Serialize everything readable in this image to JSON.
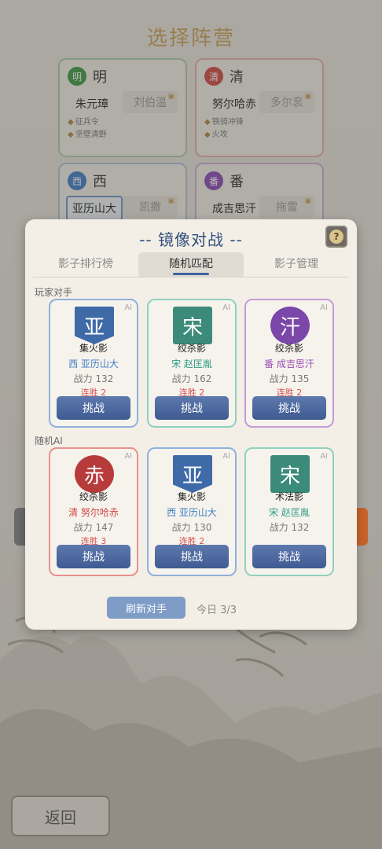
{
  "background": {
    "title": "选择阵营",
    "factions": [
      {
        "badge": "明",
        "name": "明",
        "leader": "朱元璋",
        "alt": "刘伯温",
        "skills": [
          "征兵令",
          "坚壁清野"
        ],
        "color": "#3a9a45"
      },
      {
        "badge": "清",
        "name": "清",
        "leader": "努尔哈赤",
        "alt": "多尔衮",
        "skills": [
          "铁骑冲锋",
          "火攻"
        ],
        "color": "#d24a45"
      },
      {
        "badge": "西",
        "name": "西",
        "leader": "亚历山大",
        "alt": "凯撒",
        "skills": [],
        "color": "#3e7fc8"
      },
      {
        "badge": "番",
        "name": "番",
        "leader": "成吉思汗",
        "alt": "拖雷",
        "skills": [],
        "color": "#8a4ab8"
      }
    ],
    "back_label": "返回"
  },
  "modal": {
    "title": "-- 镜像对战 --",
    "help": "?",
    "tabs": [
      "影子排行榜",
      "随机匹配",
      "影子管理"
    ],
    "active_tab": 1,
    "sections": [
      {
        "label": "玩家对手",
        "cards": [
          {
            "ai": "AI",
            "emblem": "亚",
            "shape": "banner",
            "emblem_color": "#3f6aa8",
            "border": "#8fb1dc",
            "name": "集火影",
            "faction": "西  亚历山大",
            "faction_color": "#3f7fc6",
            "power": "战力 132",
            "streak": "连胜 2",
            "button": "挑战"
          },
          {
            "ai": "AI",
            "emblem": "宋",
            "shape": "square",
            "emblem_color": "#3c8b7a",
            "border": "#8fd1c0",
            "name": "绞杀影",
            "faction": "宋  赵匡胤",
            "faction_color": "#2e9c86",
            "power": "战力 162",
            "streak": "连胜 2",
            "button": "挑战"
          },
          {
            "ai": "AI",
            "emblem": "汗",
            "shape": "round",
            "emblem_color": "#7b47a8",
            "border": "#c79ad8",
            "name": "绞杀影",
            "faction": "番  成吉思汗",
            "faction_color": "#9b4db8",
            "power": "战力 135",
            "streak": "连胜 2",
            "button": "挑战"
          }
        ]
      },
      {
        "label": "随机AI",
        "cards": [
          {
            "ai": "AI",
            "emblem": "赤",
            "shape": "round",
            "emblem_color": "#b73b3b",
            "border": "#e7918c",
            "name": "绞杀影",
            "faction": "清  努尔哈赤",
            "faction_color": "#d04848",
            "power": "战力 147",
            "streak": "连胜 3",
            "button": "挑战"
          },
          {
            "ai": "AI",
            "emblem": "亚",
            "shape": "banner",
            "emblem_color": "#3f6aa8",
            "border": "#8fb1dc",
            "name": "集火影",
            "faction": "西  亚历山大",
            "faction_color": "#3f7fc6",
            "power": "战力 130",
            "streak": "连胜 2",
            "button": "挑战"
          },
          {
            "ai": "AI",
            "emblem": "宋",
            "shape": "square",
            "emblem_color": "#3c8b7a",
            "border": "#8fd1c0",
            "name": "术法影",
            "faction": "宋  赵匡胤",
            "faction_color": "#2e9c86",
            "power": "战力 132",
            "streak": "",
            "button": "挑战"
          }
        ]
      }
    ],
    "refresh_label": "刷新对手",
    "today_label": "今日 3/3"
  }
}
